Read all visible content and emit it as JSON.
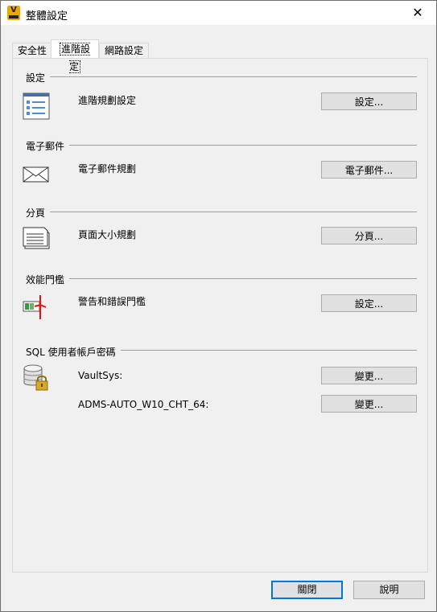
{
  "window": {
    "title": "整體設定",
    "app_icon_letter": "V"
  },
  "tabs": [
    {
      "label": "安全性"
    },
    {
      "label": "進階設定"
    },
    {
      "label": "網路設定"
    }
  ],
  "sections": {
    "settings": {
      "title": "設定",
      "label": "進階規劃設定",
      "button": "設定..."
    },
    "email": {
      "title": "電子郵件",
      "label": "電子郵件規劃",
      "button": "電子郵件..."
    },
    "paging": {
      "title": "分頁",
      "label": "頁面大小規劃",
      "button": "分頁..."
    },
    "threshold": {
      "title": "效能門檻",
      "label": "警告和錯誤門檻",
      "button": "設定..."
    },
    "sql": {
      "title": "SQL 使用者帳戶密碼",
      "row1_label": "VaultSys:",
      "row1_button": "變更...",
      "row2_label": "ADMS-AUTO_W10_CHT_64:",
      "row2_button": "變更..."
    }
  },
  "footer": {
    "close_label": "關閉",
    "help_label": "說明"
  },
  "colors": {
    "accent": "#0078d7",
    "app_icon": "#e8a800",
    "threshold_marker": "#e81010"
  }
}
